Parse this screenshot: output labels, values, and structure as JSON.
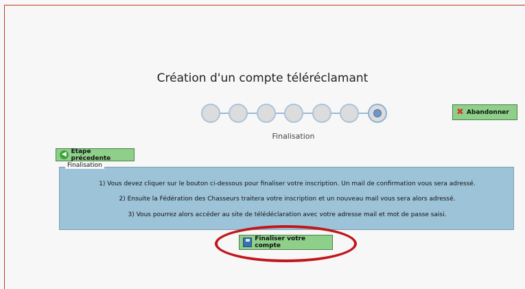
{
  "page": {
    "title": "Création d'un compte téléréclamant",
    "current_step_label": "Finalisation"
  },
  "stepper": {
    "total_steps": 7,
    "current_step": 7
  },
  "buttons": {
    "abandon": "Abandonner",
    "previous": "Etape précedente",
    "finalize": "Finaliser votre compte"
  },
  "finalisation": {
    "legend": "Finalisation",
    "lines": [
      "1) Vous devez cliquer sur le bouton ci-dessous pour finaliser votre inscription. Un mail de confirmation vous sera adressé.",
      "2) Ensuite la Fédération des Chasseurs traitera votre inscription et un nouveau mail vous sera alors adressé.",
      "3) Vous pourrez alors accéder au site de télédéclaration avec votre adresse mail et mot de passe saisi."
    ]
  },
  "colors": {
    "panel": "#9dc3d8",
    "button": "#8ed08a",
    "highlight": "#c0171c"
  }
}
